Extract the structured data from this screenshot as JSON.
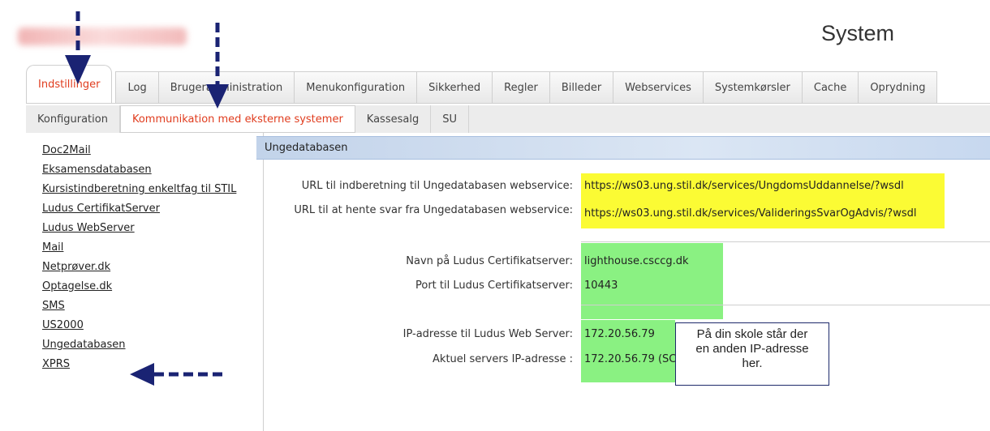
{
  "header": {
    "system_title": "System"
  },
  "colors": {
    "accent": "#e03c1e",
    "highlight_yellow": "#fbfb34",
    "highlight_green": "#8af182",
    "arrow": "#1a2373",
    "section_bar": "#c2d3ea"
  },
  "main_tabs": [
    {
      "label": "Indstillinger",
      "active": true
    },
    {
      "label": "Log",
      "active": false
    },
    {
      "label": "Brugeradministration",
      "active": false
    },
    {
      "label": "Menukonfiguration",
      "active": false
    },
    {
      "label": "Sikkerhed",
      "active": false
    },
    {
      "label": "Regler",
      "active": false
    },
    {
      "label": "Billeder",
      "active": false
    },
    {
      "label": "Webservices",
      "active": false
    },
    {
      "label": "Systemkørsler",
      "active": false
    },
    {
      "label": "Cache",
      "active": false
    },
    {
      "label": "Oprydning",
      "active": false
    }
  ],
  "sub_tabs": [
    {
      "label": "Konfiguration",
      "active": false
    },
    {
      "label": "Kommunikation med eksterne systemer",
      "active": true
    },
    {
      "label": "Kassesalg",
      "active": false
    },
    {
      "label": "SU",
      "active": false
    }
  ],
  "sidebar": {
    "items": [
      {
        "label": "Doc2Mail"
      },
      {
        "label": "Eksamensdatabasen"
      },
      {
        "label": "Kursistindberetning enkeltfag til STIL"
      },
      {
        "label": "Ludus CertifikatServer"
      },
      {
        "label": "Ludus WebServer"
      },
      {
        "label": "Mail"
      },
      {
        "label": "Netprøver.dk"
      },
      {
        "label": "Optagelse.dk"
      },
      {
        "label": "SMS"
      },
      {
        "label": "US2000"
      },
      {
        "label": "Ungedatabasen",
        "selected": true
      },
      {
        "label": "XPRS"
      }
    ]
  },
  "section": {
    "title": "Ungedatabasen"
  },
  "fields": {
    "url_indberetning": {
      "label": "URL til indberetning til Ungedatabasen webservice:",
      "value": "https://ws03.ung.stil.dk/services/UngdomsUddannelse/?wsdl"
    },
    "url_svar": {
      "label": "URL til at hente svar fra Ungedatabasen webservice:",
      "value": "https://ws03.ung.stil.dk/services/ValideringsSvarOgAdvis/?wsdl"
    },
    "cert_name": {
      "label": "Navn på Ludus Certifikatserver:",
      "value": "lighthouse.csccg.dk"
    },
    "cert_port": {
      "label": "Port til Ludus Certifikatserver:",
      "value": "10443"
    },
    "web_ip": {
      "label": "IP-adresse til Ludus Web Server:",
      "value": "172.20.56.79"
    },
    "current_ip": {
      "label": "Aktuel servers IP-adresse :",
      "value": "172.20.56.79 (SC"
    }
  },
  "callout": {
    "line1": "På din skole står der",
    "line2": "en anden IP-adresse",
    "line3": "her."
  }
}
